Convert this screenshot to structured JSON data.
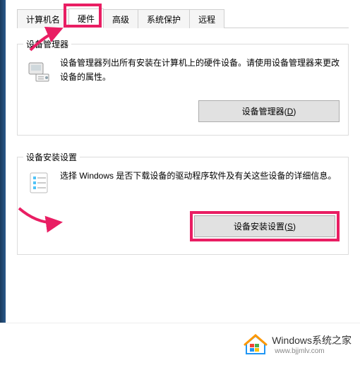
{
  "tabs": {
    "computerName": "计算机名",
    "hardware": "硬件",
    "advanced": "高级",
    "systemProtection": "系统保护",
    "remote": "远程"
  },
  "deviceManager": {
    "title": "设备管理器",
    "description": "设备管理器列出所有安装在计算机上的硬件设备。请使用设备管理器来更改设备的属性。",
    "buttonLabel": "设备管理器(D)",
    "iconName": "device-manager-icon"
  },
  "deviceInstall": {
    "title": "设备安装设置",
    "description": "选择 Windows 是否下载设备的驱动程序软件及有关这些设备的详细信息。",
    "buttonLabel": "设备安装设置(S)",
    "iconName": "checklist-icon"
  },
  "watermark": {
    "brand": "Windows系统之家",
    "url": "www.bjjmlv.com"
  },
  "highlightColor": "#e91e63"
}
